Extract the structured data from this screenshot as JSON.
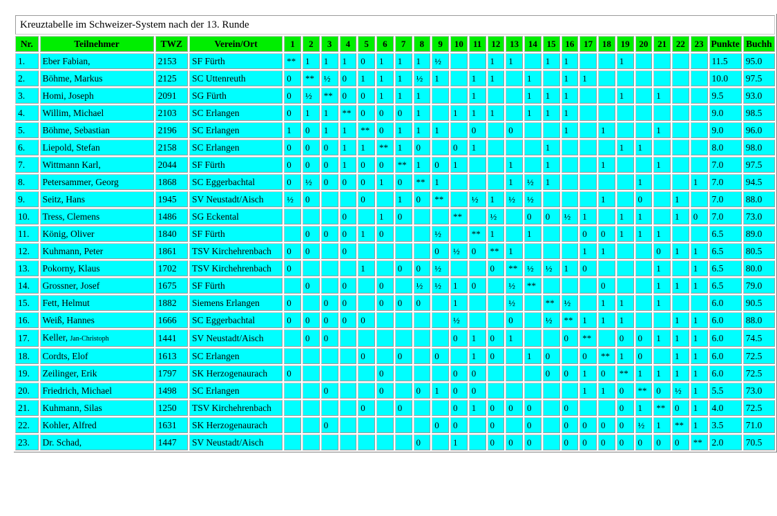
{
  "caption": "Kreuztabelle im Schweizer-System nach der 13. Runde",
  "colors": {
    "header_bg": "#00ee00",
    "cell_bg": "#00ffff",
    "page_bg": "#ffffff",
    "border": "#9a9a9a"
  },
  "headers": {
    "nr": "Nr.",
    "name": "Teilnehmer",
    "twz": "TWZ",
    "club": "Verein/Ort",
    "rounds": [
      "1",
      "2",
      "3",
      "4",
      "5",
      "6",
      "7",
      "8",
      "9",
      "10",
      "11",
      "12",
      "13",
      "14",
      "15",
      "16",
      "17",
      "18",
      "19",
      "20",
      "21",
      "22",
      "23"
    ],
    "points": "Punkte",
    "buchholz": "Buchh"
  },
  "rows": [
    {
      "nr": "1.",
      "name": "Eber Fabian,",
      "name_suffix": "",
      "twz": "2153",
      "club": "SF Fürth",
      "cells": [
        "**",
        "1",
        "1",
        "1",
        "0",
        "1",
        "1",
        "1",
        "½",
        "",
        "",
        "1",
        "1",
        "",
        "1",
        "1",
        "",
        "",
        "1",
        "",
        "",
        "",
        ""
      ],
      "points": "11.5",
      "buchholz": "95.0"
    },
    {
      "nr": "2.",
      "name": "Böhme, Markus",
      "name_suffix": "",
      "twz": "2125",
      "club": "SC Uttenreuth",
      "cells": [
        "0",
        "**",
        "½",
        "0",
        "1",
        "1",
        "1",
        "½",
        "1",
        "",
        "1",
        "1",
        "",
        "1",
        "",
        "1",
        "1",
        "",
        "",
        "",
        "",
        "",
        ""
      ],
      "points": "10.0",
      "buchholz": "97.5"
    },
    {
      "nr": "3.",
      "name": "Homi, Joseph",
      "name_suffix": "",
      "twz": "2091",
      "club": "SG Fürth",
      "cells": [
        "0",
        "½",
        "**",
        "0",
        "0",
        "1",
        "1",
        "1",
        "",
        "",
        "1",
        "",
        "",
        "1",
        "1",
        "1",
        "",
        "",
        "1",
        "",
        "1",
        "",
        ""
      ],
      "points": "9.5",
      "buchholz": "93.0"
    },
    {
      "nr": "4.",
      "name": "Willim, Michael",
      "name_suffix": "",
      "twz": "2103",
      "club": "SC Erlangen",
      "cells": [
        "0",
        "1",
        "1",
        "**",
        "0",
        "0",
        "0",
        "1",
        "",
        "1",
        "1",
        "1",
        "",
        "1",
        "1",
        "1",
        "",
        "",
        "",
        "",
        "",
        "",
        ""
      ],
      "points": "9.0",
      "buchholz": "98.5"
    },
    {
      "nr": "5.",
      "name": "Böhme, Sebastian",
      "name_suffix": "",
      "twz": "2196",
      "club": "SC Erlangen",
      "cells": [
        "1",
        "0",
        "1",
        "1",
        "**",
        "0",
        "1",
        "1",
        "1",
        "",
        "0",
        "",
        "0",
        "",
        "",
        "1",
        "",
        "1",
        "",
        "",
        "1",
        "",
        ""
      ],
      "points": "9.0",
      "buchholz": "96.0"
    },
    {
      "nr": "6.",
      "name": "Liepold, Stefan",
      "name_suffix": "",
      "twz": "2158",
      "club": "SC Erlangen",
      "cells": [
        "0",
        "0",
        "0",
        "1",
        "1",
        "**",
        "1",
        "0",
        "",
        "0",
        "1",
        "",
        "",
        "",
        "1",
        "",
        "",
        "",
        "1",
        "1",
        "",
        "",
        ""
      ],
      "points": "8.0",
      "buchholz": "98.0"
    },
    {
      "nr": "7.",
      "name": "Wittmann Karl,",
      "name_suffix": "",
      "twz": "2044",
      "club": "SF Fürth",
      "cells": [
        "0",
        "0",
        "0",
        "1",
        "0",
        "0",
        "**",
        "1",
        "0",
        "1",
        "",
        "",
        "1",
        "",
        "1",
        "",
        "",
        "1",
        "",
        "",
        "1",
        "",
        ""
      ],
      "points": "7.0",
      "buchholz": "97.5"
    },
    {
      "nr": "8.",
      "name": "Petersammer, Georg",
      "name_suffix": "",
      "twz": "1868",
      "club": "SC Eggerbachtal",
      "cells": [
        "0",
        "½",
        "0",
        "0",
        "0",
        "1",
        "0",
        "**",
        "1",
        "",
        "",
        "",
        "1",
        "½",
        "1",
        "",
        "",
        "",
        "",
        "1",
        "",
        "",
        "1"
      ],
      "points": "7.0",
      "buchholz": "94.5"
    },
    {
      "nr": "9.",
      "name": "Seitz, Hans",
      "name_suffix": "",
      "twz": "1945",
      "club": "SV Neustadt/Aisch",
      "cells": [
        "½",
        "0",
        "",
        "",
        "0",
        "",
        "1",
        "0",
        "**",
        "",
        "½",
        "1",
        "½",
        "½",
        "",
        "",
        "",
        "1",
        "",
        "0",
        "",
        "1",
        ""
      ],
      "points": "7.0",
      "buchholz": "88.0"
    },
    {
      "nr": "10.",
      "name": "Tress, Clemens",
      "name_suffix": "",
      "twz": "1486",
      "club": "SG Eckental",
      "cells": [
        "",
        "",
        "",
        "0",
        "",
        "1",
        "0",
        "",
        "",
        "**",
        "",
        "½",
        "",
        "0",
        "0",
        "½",
        "1",
        "",
        "1",
        "1",
        "",
        "1",
        "0"
      ],
      "points": "7.0",
      "buchholz": "73.0"
    },
    {
      "nr": "11.",
      "name": "König, Oliver",
      "name_suffix": "",
      "twz": "1840",
      "club": "SF Fürth",
      "cells": [
        "",
        "0",
        "0",
        "0",
        "1",
        "0",
        "",
        "",
        "½",
        "",
        "**",
        "1",
        "",
        "1",
        "",
        "",
        "0",
        "0",
        "1",
        "1",
        "1",
        "",
        ""
      ],
      "points": "6.5",
      "buchholz": "89.0"
    },
    {
      "nr": "12.",
      "name": "Kuhmann, Peter",
      "name_suffix": "",
      "twz": "1861",
      "club": "TSV Kirchehrenbach",
      "cells": [
        "0",
        "0",
        "",
        "0",
        "",
        "",
        "",
        "",
        "0",
        "½",
        "0",
        "**",
        "1",
        "",
        "",
        "",
        "1",
        "1",
        "",
        "",
        "0",
        "1",
        "1"
      ],
      "points": "6.5",
      "buchholz": "80.5"
    },
    {
      "nr": "13.",
      "name": "Pokorny, Klaus",
      "name_suffix": "",
      "twz": "1702",
      "club": "TSV Kirchehrenbach",
      "cells": [
        "0",
        "",
        "",
        "",
        "1",
        "",
        "0",
        "0",
        "½",
        "",
        "",
        "0",
        "**",
        "½",
        "½",
        "1",
        "0",
        "",
        "",
        "",
        "1",
        "",
        "1"
      ],
      "points": "6.5",
      "buchholz": "80.0"
    },
    {
      "nr": "14.",
      "name": "Grossner, Josef",
      "name_suffix": "",
      "twz": "1675",
      "club": "SF Fürth",
      "cells": [
        "",
        "0",
        "",
        "0",
        "",
        "0",
        "",
        "½",
        "½",
        "1",
        "0",
        "",
        "½",
        "**",
        "",
        "",
        "",
        "0",
        "",
        "",
        "1",
        "1",
        "1"
      ],
      "points": "6.5",
      "buchholz": "79.0"
    },
    {
      "nr": "15.",
      "name": "Fett, Helmut",
      "name_suffix": "",
      "twz": "1882",
      "club": "Siemens Erlangen",
      "cells": [
        "0",
        "",
        "0",
        "0",
        "",
        "0",
        "0",
        "0",
        "",
        "1",
        "",
        "",
        "½",
        "",
        "**",
        "½",
        "",
        "1",
        "1",
        "",
        "1",
        "",
        ""
      ],
      "points": "6.0",
      "buchholz": "90.5"
    },
    {
      "nr": "16.",
      "name": "Weiß, Hannes",
      "name_suffix": "",
      "twz": "1666",
      "club": "SC Eggerbachtal",
      "cells": [
        "0",
        "0",
        "0",
        "0",
        "0",
        "",
        "",
        "",
        "",
        "½",
        "",
        "",
        "0",
        "",
        "½",
        "**",
        "1",
        "1",
        "1",
        "",
        "",
        "1",
        "1"
      ],
      "points": "6.0",
      "buchholz": "88.0"
    },
    {
      "nr": "17.",
      "name": "Keller,",
      "name_suffix": "Jan-Christoph",
      "twz": "1441",
      "club": "SV Neustadt/Aisch",
      "cells": [
        "",
        "0",
        "0",
        "",
        "",
        "",
        "",
        "",
        "",
        "0",
        "1",
        "0",
        "1",
        "",
        "",
        "0",
        "**",
        "",
        "0",
        "0",
        "1",
        "1",
        "1"
      ],
      "points": "6.0",
      "buchholz": "74.5"
    },
    {
      "nr": "18.",
      "name": "Cordts, Elof",
      "name_suffix": "",
      "twz": "1613",
      "club": "SC Erlangen",
      "cells": [
        "",
        "",
        "",
        "",
        "0",
        "",
        "0",
        "",
        "0",
        "",
        "1",
        "0",
        "",
        "1",
        "0",
        "",
        "0",
        "**",
        "1",
        "0",
        "",
        "1",
        "1"
      ],
      "points": "6.0",
      "buchholz": "72.5"
    },
    {
      "nr": "19.",
      "name": "Zeilinger, Erik",
      "name_suffix": "",
      "twz": "1797",
      "club": "SK Herzogenaurach",
      "cells": [
        "0",
        "",
        "",
        "",
        "",
        "0",
        "",
        "",
        "",
        "0",
        "0",
        "",
        "",
        "",
        "0",
        "0",
        "1",
        "0",
        "**",
        "1",
        "1",
        "1",
        "1"
      ],
      "points": "6.0",
      "buchholz": "72.5"
    },
    {
      "nr": "20.",
      "name": "Friedrich, Michael",
      "name_suffix": "",
      "twz": "1498",
      "club": "SC Erlangen",
      "cells": [
        "",
        "",
        "0",
        "",
        "",
        "0",
        "",
        "0",
        "1",
        "0",
        "0",
        "",
        "",
        "",
        "",
        "",
        "1",
        "1",
        "0",
        "**",
        "0",
        "½",
        "1"
      ],
      "points": "5.5",
      "buchholz": "73.0"
    },
    {
      "nr": "21.",
      "name": "Kuhmann, Silas",
      "name_suffix": "",
      "twz": "1250",
      "club": "TSV Kirchehrenbach",
      "cells": [
        "",
        "",
        "",
        "",
        "0",
        "",
        "0",
        "",
        "",
        "0",
        "1",
        "0",
        "0",
        "0",
        "",
        "0",
        "",
        "",
        "0",
        "1",
        "**",
        "0",
        "1"
      ],
      "points": "4.0",
      "buchholz": "72.5"
    },
    {
      "nr": "22.",
      "name": "Kohler, Alfred",
      "name_suffix": "",
      "twz": "1631",
      "club": "SK Herzogenaurach",
      "cells": [
        "",
        "",
        "0",
        "",
        "",
        "",
        "",
        "",
        "0",
        "0",
        "",
        "0",
        "",
        "0",
        "",
        "0",
        "0",
        "0",
        "0",
        "½",
        "1",
        "**",
        "1"
      ],
      "points": "3.5",
      "buchholz": "71.0"
    },
    {
      "nr": "23.",
      "name": "Dr. Schad,",
      "name_suffix": "",
      "twz": "1447",
      "club": "SV Neustadt/Aisch",
      "cells": [
        "",
        "",
        "",
        "",
        "",
        "",
        "",
        "0",
        "",
        "1",
        "",
        "0",
        "0",
        "0",
        "",
        "0",
        "0",
        "0",
        "0",
        "0",
        "0",
        "0",
        "**"
      ],
      "points": "2.0",
      "buchholz": "70.5"
    }
  ]
}
